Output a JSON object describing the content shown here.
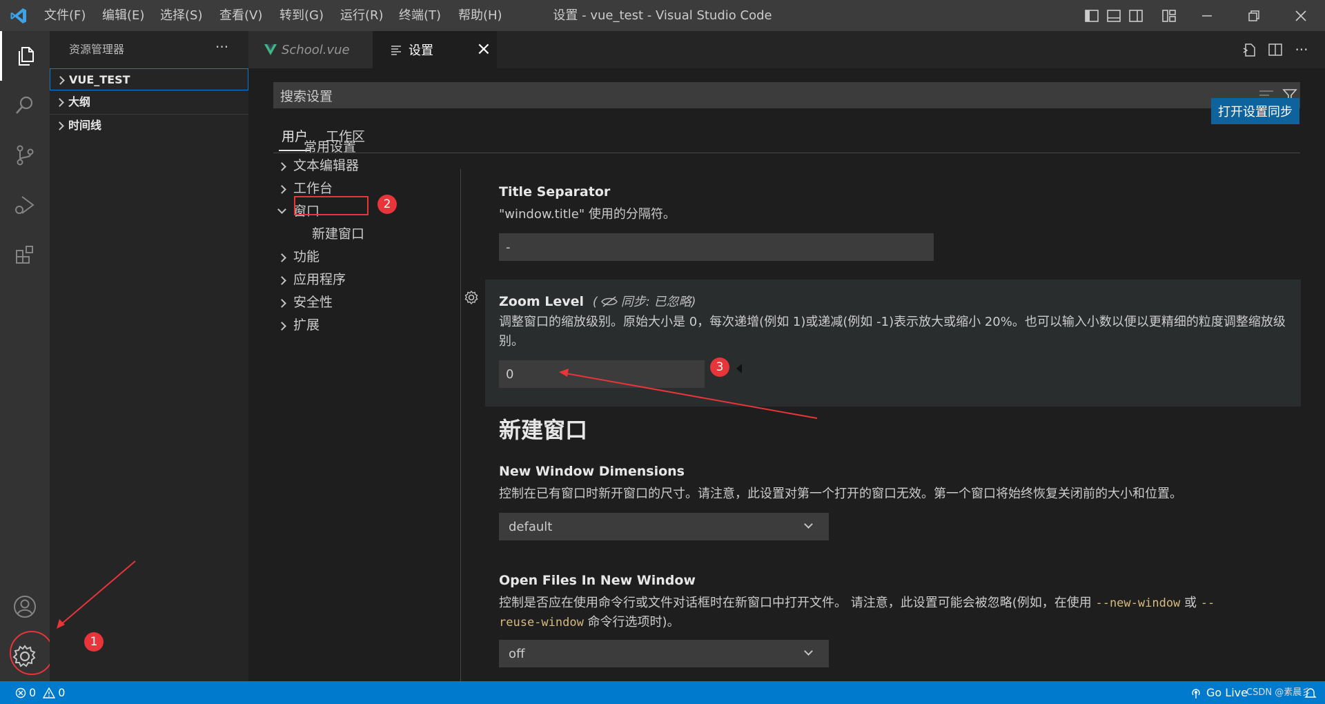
{
  "window": {
    "title": "设置 - vue_test - Visual Studio Code",
    "menu": [
      "文件(F)",
      "编辑(E)",
      "选择(S)",
      "查看(V)",
      "转到(G)",
      "运行(R)",
      "终端(T)",
      "帮助(H)"
    ]
  },
  "activity_bar": {
    "items": [
      "files-icon",
      "search-icon",
      "source-control-icon",
      "run-debug-icon",
      "extensions-icon"
    ],
    "bottom": [
      "account-icon",
      "settings-gear-icon"
    ]
  },
  "sidebar": {
    "header": "资源管理器",
    "more": "···",
    "sections": [
      "VUE_TEST",
      "大纲",
      "时间线"
    ]
  },
  "tabs": [
    {
      "label": "School.vue",
      "icon": "vue-icon",
      "active": false
    },
    {
      "label": "设置",
      "icon": "settings-doc-icon",
      "active": true,
      "close": "×"
    }
  ],
  "settings": {
    "search_placeholder": "搜索设置",
    "scope_tabs": [
      "用户",
      "工作区"
    ],
    "sync_button": "打开设置同步",
    "toc": [
      "常用设置",
      "文本编辑器",
      "工作台",
      "窗口",
      "新建窗口",
      "功能",
      "应用程序",
      "安全性",
      "扩展"
    ],
    "title_separator": {
      "title": "Title Separator",
      "desc": "\"window.title\" 使用的分隔符。",
      "value": "-"
    },
    "zoom_level": {
      "title": "Zoom Level",
      "sync_note": "同步: 已忽略)",
      "sync_open": "(",
      "desc": "调整窗口的缩放级别。原始大小是 0，每次递增(例如 1)或递减(例如 -1)表示放大或缩小 20%。也可以输入小数以便以更精细的粒度调整缩放级别。",
      "value": "0"
    },
    "section_heading": "新建窗口",
    "new_window_dimensions": {
      "title": "New Window Dimensions",
      "desc": "控制在已有窗口时新开窗口的尺寸。请注意，此设置对第一个打开的窗口无效。第一个窗口将始终恢复关闭前的大小和位置。",
      "value": "default"
    },
    "open_files_in_new_window": {
      "title": "Open Files In New Window",
      "desc_a": "控制是否应在使用命令行或文件对话框时在新窗口中打开文件。 请注意，此设置可能会被忽略(例如，在使用 ",
      "code_a": "--new-window",
      "desc_b": " 或 ",
      "code_b": "--",
      "code_c": "reuse-window",
      "desc_c": " 命令行选项时)。",
      "value": "off"
    }
  },
  "annotations": {
    "badge1": "1",
    "badge2": "2",
    "badge3": "3"
  },
  "statusbar": {
    "errors": "0",
    "warnings": "0",
    "go_live": "Go Live",
    "watermark": "CSDN @素晨彡"
  },
  "colors": {
    "accent": "#007acc",
    "sync_button": "#0e639c",
    "annotation": "#e8353a"
  }
}
